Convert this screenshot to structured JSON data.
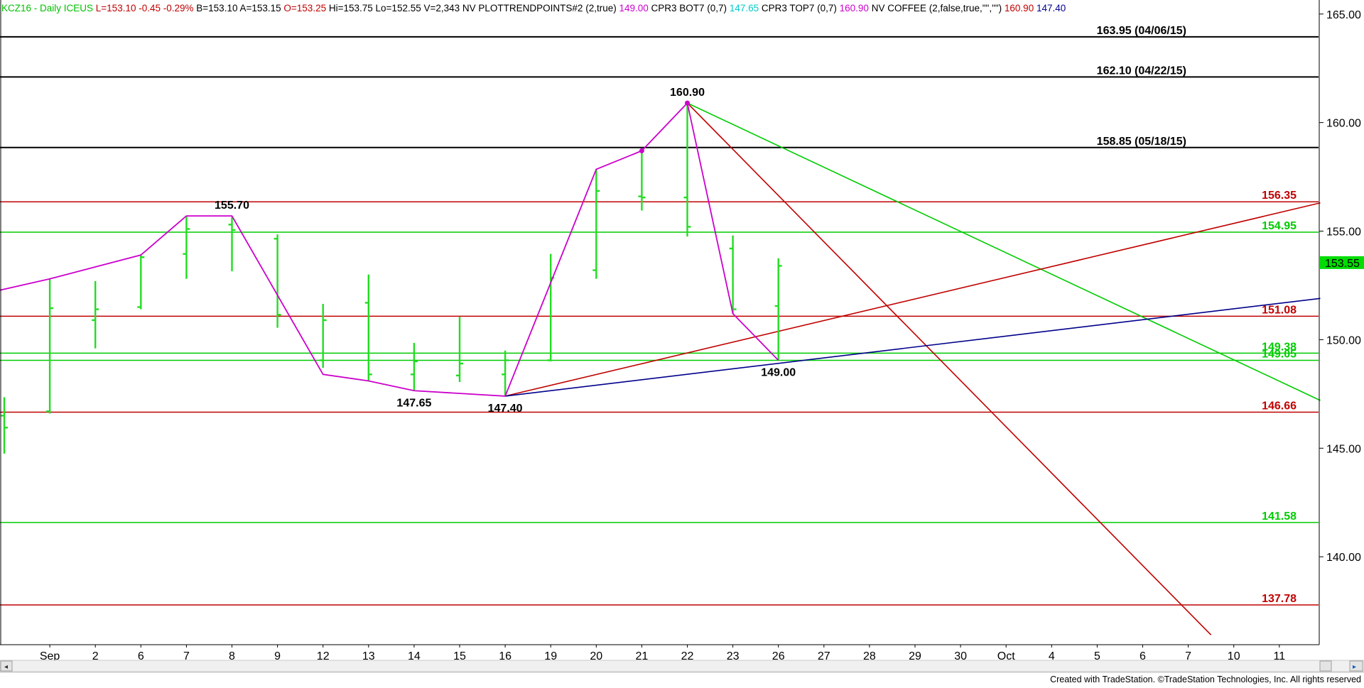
{
  "header": [
    {
      "text": "KCZ16 - Daily  ICEUS",
      "color": "#00c000"
    },
    {
      "text": "L=153.10",
      "color": "#c00000"
    },
    {
      "text": "-0.45",
      "color": "#c00000"
    },
    {
      "text": "-0.29%",
      "color": "#c00000"
    },
    {
      "text": "B=153.10",
      "color": "#000000"
    },
    {
      "text": "A=153.15",
      "color": "#000000"
    },
    {
      "text": "O=153.25",
      "color": "#c00000"
    },
    {
      "text": "Hi=153.75",
      "color": "#000000"
    },
    {
      "text": "Lo=152.55",
      "color": "#000000"
    },
    {
      "text": "V=2,343",
      "color": "#000000"
    },
    {
      "text": "NV  PLOTTRENDPOINTS#2 (2,true)",
      "color": "#000000"
    },
    {
      "text": "149.00",
      "color": "#cc00cc"
    },
    {
      "text": "CPR3 BOT7 (0,7)",
      "color": "#000000"
    },
    {
      "text": "147.65",
      "color": "#00cccc"
    },
    {
      "text": "CPR3 TOP7 (0,7)",
      "color": "#000000"
    },
    {
      "text": "160.90",
      "color": "#cc00cc"
    },
    {
      "text": "NV COFFEE (2,false,true,\"\",\"\")",
      "color": "#000000"
    },
    {
      "text": "160.90",
      "color": "#c00000"
    },
    {
      "text": "147.40",
      "color": "#000090"
    }
  ],
  "footer_text": "Created with TradeStation. ©TradeStation Technologies, Inc. All rights reserved",
  "chart_data": {
    "type": "bar",
    "style": "OHLC",
    "ylim": [
      135.95,
      165.45
    ],
    "y_ticks": [
      140,
      145,
      150,
      155,
      160,
      165
    ],
    "y_tick_labels": [
      "140.00",
      "145.00",
      "150.00",
      "155.00",
      "160.00",
      "165.00"
    ],
    "x_labels": [
      "Sep",
      "2",
      "6",
      "7",
      "8",
      "9",
      "12",
      "13",
      "14",
      "15",
      "16",
      "19",
      "20",
      "21",
      "22",
      "23",
      "26",
      "27",
      "28",
      "29",
      "30",
      "Oct",
      "4",
      "5",
      "6",
      "7",
      "10",
      "11"
    ],
    "x_label_slots": [
      1,
      2,
      3,
      4,
      5,
      6,
      7,
      8,
      9,
      10,
      11,
      12,
      13,
      14,
      15,
      16,
      17,
      18,
      19,
      20,
      21,
      22,
      23,
      24,
      25,
      26,
      27,
      28
    ],
    "bars": [
      {
        "x": 0,
        "high": 147.35,
        "low": 144.75,
        "open": 146.5,
        "close": 145.95
      },
      {
        "x": 1,
        "high": 152.8,
        "low": 146.6,
        "open": 146.7,
        "close": 151.45
      },
      {
        "x": 2,
        "high": 152.7,
        "low": 149.6,
        "open": 150.9,
        "close": 151.4
      },
      {
        "x": 3,
        "high": 153.9,
        "low": 151.4,
        "open": 151.5,
        "close": 153.8
      },
      {
        "x": 4,
        "high": 155.7,
        "low": 152.8,
        "open": 153.95,
        "close": 155.1
      },
      {
        "x": 5,
        "high": 155.65,
        "low": 153.15,
        "open": 155.3,
        "close": 155.05
      },
      {
        "x": 6,
        "high": 154.85,
        "low": 150.55,
        "open": 154.65,
        "close": 151.15
      },
      {
        "x": 7,
        "high": 151.65,
        "low": 148.7,
        "open": 149.05,
        "close": 150.9
      },
      {
        "x": 8,
        "high": 153.0,
        "low": 148.1,
        "open": 151.7,
        "close": 148.4
      },
      {
        "x": 9,
        "high": 149.85,
        "low": 147.65,
        "open": 148.4,
        "close": 149.0
      },
      {
        "x": 10,
        "high": 151.05,
        "low": 148.05,
        "open": 148.35,
        "close": 148.9
      },
      {
        "x": 11,
        "high": 149.5,
        "low": 147.4,
        "open": 148.4,
        "close": 149.05
      },
      {
        "x": 12,
        "high": 153.95,
        "low": 149.0,
        "open": 149.05,
        "close": 152.85
      },
      {
        "x": 13,
        "high": 157.85,
        "low": 152.8,
        "open": 153.2,
        "close": 156.85
      },
      {
        "x": 14,
        "high": 158.7,
        "low": 155.95,
        "open": 156.6,
        "close": 156.55
      },
      {
        "x": 15,
        "high": 160.9,
        "low": 154.75,
        "open": 156.55,
        "close": 155.2
      },
      {
        "x": 16,
        "high": 154.8,
        "low": 151.2,
        "open": 154.2,
        "close": 151.4
      },
      {
        "x": 17,
        "high": 153.75,
        "low": 149.05,
        "open": 151.55,
        "close": 153.4
      }
    ],
    "horizontal_levels": [
      {
        "value": 163.95,
        "label": "163.95 (04/06/15)",
        "color": "#000000"
      },
      {
        "value": 162.1,
        "label": "162.10 (04/22/15)",
        "color": "#000000"
      },
      {
        "value": 158.85,
        "label": "158.85 (05/18/15)",
        "color": "#000000"
      },
      {
        "value": 156.35,
        "label": "156.35",
        "color": "#c00000"
      },
      {
        "value": 154.95,
        "label": "154.95",
        "color": "#00cc00"
      },
      {
        "value": 151.08,
        "label": "151.08",
        "color": "#c00000"
      },
      {
        "value": 149.38,
        "label": "149.38",
        "color": "#00cc00"
      },
      {
        "value": 149.05,
        "label": "149.05",
        "color": "#00cc00"
      },
      {
        "value": 146.66,
        "label": "146.66",
        "color": "#c00000"
      },
      {
        "value": 141.58,
        "label": "141.58",
        "color": "#00cc00"
      },
      {
        "value": 137.78,
        "label": "137.78",
        "color": "#c00000"
      }
    ],
    "last_price": {
      "value": 153.55,
      "label": "153.55",
      "color": "#00dd00"
    },
    "pivot_path": [
      {
        "x": -1,
        "y": 151.85
      },
      {
        "x": 1,
        "y": 152.8
      },
      {
        "x": 3,
        "y": 153.9
      },
      {
        "x": 4,
        "y": 155.7
      },
      {
        "x": 5,
        "y": 155.7
      },
      {
        "x": 7,
        "y": 148.4
      },
      {
        "x": 8,
        "y": 148.1
      },
      {
        "x": 9,
        "y": 147.65
      },
      {
        "x": 11,
        "y": 147.4
      },
      {
        "x": 13,
        "y": 157.85
      },
      {
        "x": 14,
        "y": 158.7
      },
      {
        "x": 15,
        "y": 160.9
      },
      {
        "x": 16,
        "y": 151.2
      },
      {
        "x": 17,
        "y": 149.05
      }
    ],
    "pivot_dots": [
      {
        "x": 15,
        "y": 160.9
      },
      {
        "x": 14,
        "y": 158.7
      }
    ],
    "pivot_labels": [
      {
        "x": 5,
        "y": 155.7,
        "text": "155.70"
      },
      {
        "x": 9,
        "y": 147.65,
        "text": "147.65"
      },
      {
        "x": 11,
        "y": 147.4,
        "text": "147.40"
      },
      {
        "x": 15,
        "y": 160.9,
        "text": "160.90"
      },
      {
        "x": 17,
        "y": 149.05,
        "text": "149.00"
      }
    ],
    "trendlines": [
      {
        "from": {
          "x": 15,
          "y": 160.9
        },
        "to": {
          "x": 26.5,
          "y": 136.4
        },
        "color": "#c00000"
      },
      {
        "from": {
          "x": 15,
          "y": 160.9
        },
        "to": {
          "x": 28.9,
          "y": 147.2
        },
        "color": "#00cc00"
      },
      {
        "from": {
          "x": 11,
          "y": 147.4
        },
        "to": {
          "x": 28.9,
          "y": 156.3
        },
        "color": "#c00000"
      },
      {
        "from": {
          "x": 11,
          "y": 147.4
        },
        "to": {
          "x": 28.9,
          "y": 151.9
        },
        "color": "#00008b"
      }
    ]
  }
}
